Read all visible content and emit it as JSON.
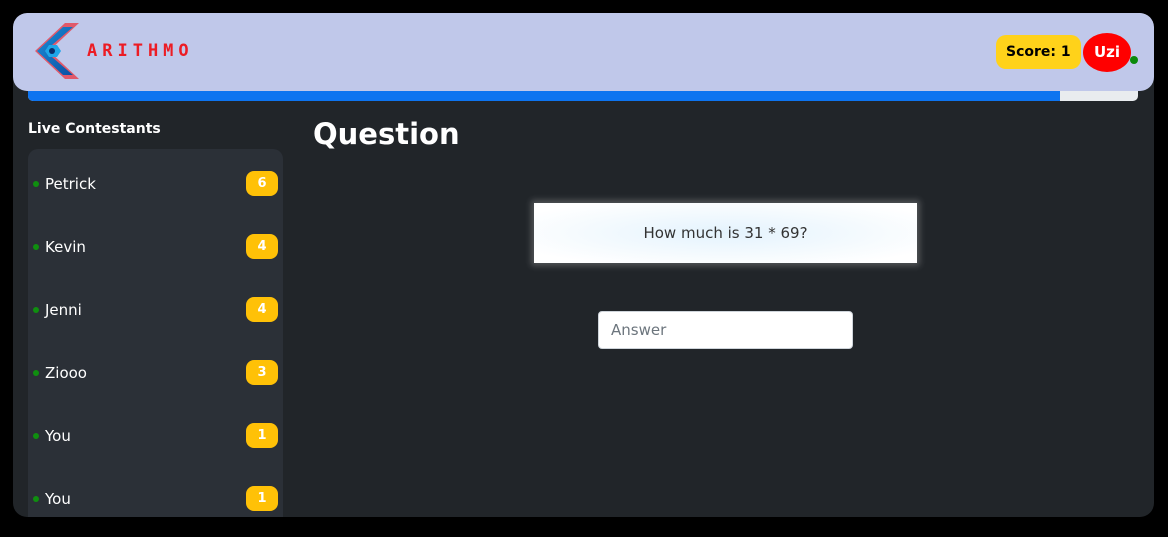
{
  "header": {
    "logo_text": "ARITHMO",
    "score_label": "Score: 1",
    "user_name": "Uzi",
    "user_online": true
  },
  "progress": {
    "percent": 93
  },
  "sidebar": {
    "title": "Live Contestants",
    "contestants": [
      {
        "name": "Petrick",
        "score": "6"
      },
      {
        "name": "Kevin",
        "score": "4"
      },
      {
        "name": "Jenni",
        "score": "4"
      },
      {
        "name": "Ziooo",
        "score": "3"
      },
      {
        "name": "You",
        "score": "1"
      },
      {
        "name": "You",
        "score": "1"
      }
    ]
  },
  "main": {
    "title": "Question",
    "question": "How much is 31 * 69?",
    "answer_value": "",
    "answer_placeholder": "Answer"
  },
  "colors": {
    "header_bg": "#c0c8ea",
    "app_bg": "#212529",
    "accent_blue": "#0d74f0",
    "badge_yellow": "#ffc107",
    "score_yellow": "#ffd21a",
    "avatar_red": "#ff0000",
    "online_green": "#0a8a0a",
    "logo_red": "#ec1c24"
  },
  "icons": {
    "logo": "arithmo-logo-icon",
    "online": "online-status-dot"
  }
}
